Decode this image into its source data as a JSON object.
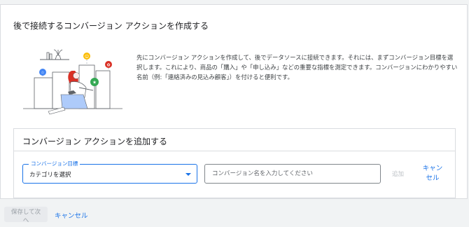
{
  "page": {
    "title": "後で接続するコンバージョン アクションを作成する",
    "description": "先にコンバージョン アクションを作成して、後でデータソースに接続できます。それには、まずコンバージョン目標を選択します。これにより、商品の「購入」や「申し込み」などの重要な指標を測定できます。コンバージョンにわかりやすい名前（例:「連絡済みの見込み顧客」）を付けると便利です。"
  },
  "section": {
    "title": "コンバージョン アクションを追加する",
    "goal_select": {
      "label": "コンバージョン目標",
      "value": "カテゴリを選択"
    },
    "name_input": {
      "placeholder": "コンバージョン名を入力してください",
      "value": ""
    },
    "add_label": "追加",
    "cancel_label": "キャンセル"
  },
  "footer": {
    "save_label": "保存して次へ",
    "cancel_label": "キャンセル"
  },
  "colors": {
    "accent": "#1a73e8",
    "illustration_red": "#d93025",
    "illustration_yellow": "#fbbc04",
    "illustration_green": "#34a853",
    "illustration_blue": "#4285f4"
  },
  "icons": [
    "star-icon",
    "smiley-icon",
    "gift-icon",
    "chevron-down-icon"
  ]
}
